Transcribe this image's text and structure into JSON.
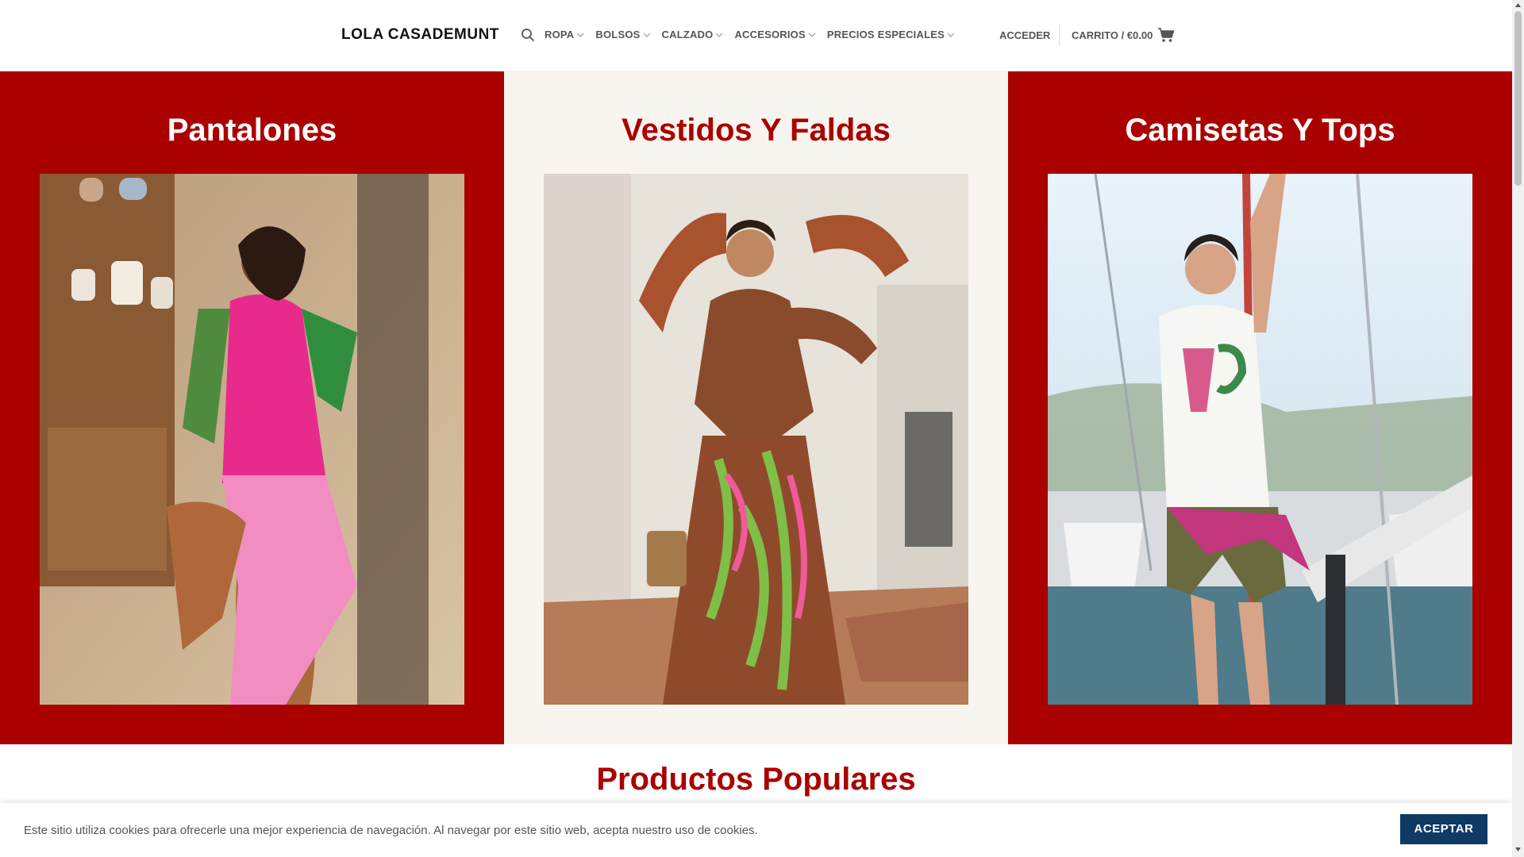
{
  "header": {
    "logo": "LOLA CASADEMUNT",
    "nav": [
      {
        "label": "ROPA"
      },
      {
        "label": "BOLSOS"
      },
      {
        "label": "CALZADO"
      },
      {
        "label": "ACCESORIOS"
      },
      {
        "label": "PRECIOS ESPECIALES"
      }
    ],
    "login": "ACCEDER",
    "cart": "CARRITO / €0.00"
  },
  "categories": [
    {
      "title": "Pantalones"
    },
    {
      "title": "Vestidos Y Faldas"
    },
    {
      "title": "Camisetas Y Tops"
    }
  ],
  "popular": {
    "title": "Productos Populares"
  },
  "cookie": {
    "text": "Este sitio utiliza cookies para ofrecerle una mejor experiencia de navegación. Al navegar por este sitio web, acepta nuestro uso de cookies.",
    "button": "ACEPTAR"
  },
  "colors": {
    "brand_red": "#aa0000",
    "cream": "#f8f5f0",
    "cookie_button": "#0e3a64"
  },
  "icons": [
    "search-icon",
    "chevron-down-icon",
    "cart-icon"
  ]
}
